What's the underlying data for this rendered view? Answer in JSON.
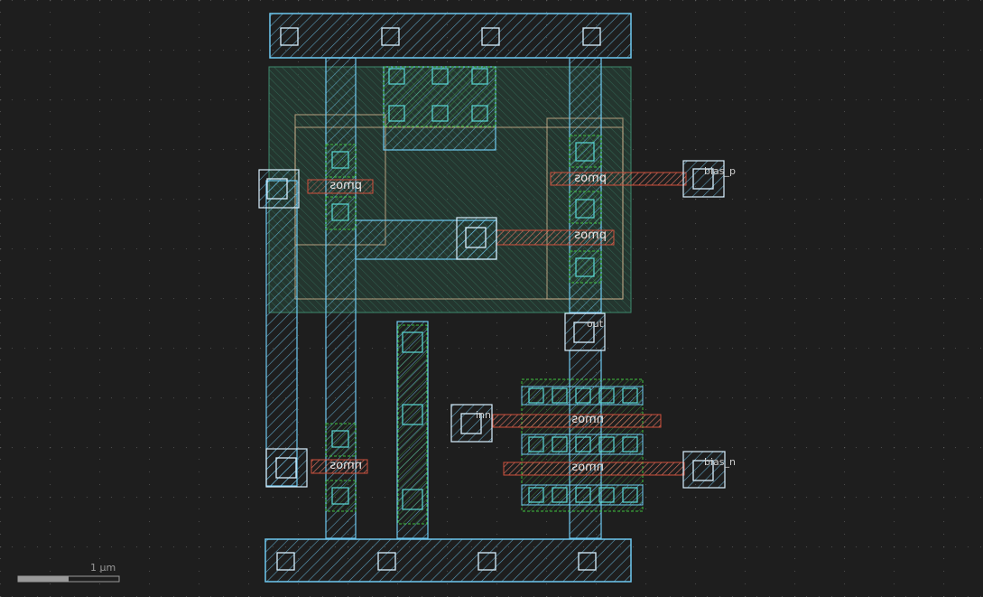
{
  "colors": {
    "background": "#1e1e1e",
    "grid_dot": "#5a5a5a",
    "metal1": "#6ec8f0",
    "nwell": "#2e6b55",
    "diffusion": "#3fbf3f",
    "poly": "#d0503c",
    "contact": "#d8f0ff",
    "implant_outline": "#d8b890"
  },
  "devices": {
    "pmos_1": "pmos",
    "pmos_2": "pmos",
    "pmos_3": "pmos",
    "nmos_1": "nmos",
    "nmos_2": "nmos",
    "nmos_3": "nmos"
  },
  "pins": {
    "bias_p": "bias_p",
    "bias_n": "bias_n",
    "out": "out",
    "inn": "inn"
  },
  "scale_bar": {
    "label": "1  μm"
  }
}
